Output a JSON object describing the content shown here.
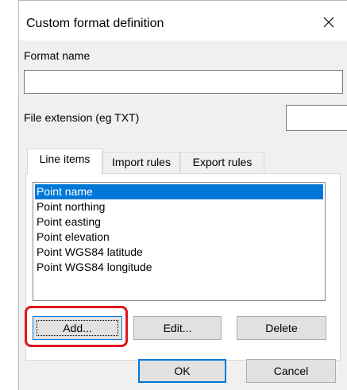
{
  "dialog": {
    "title": "Custom format definition",
    "close_icon": "close-icon"
  },
  "format_name": {
    "label": "Format name",
    "value": ""
  },
  "file_extension": {
    "label": "File extension (eg TXT)",
    "value": ""
  },
  "tabs": [
    {
      "label": "Line items",
      "active": true
    },
    {
      "label": "Import rules",
      "active": false
    },
    {
      "label": "Export rules",
      "active": false
    }
  ],
  "line_items": [
    {
      "label": "Point name",
      "selected": true
    },
    {
      "label": "Point northing",
      "selected": false
    },
    {
      "label": "Point easting",
      "selected": false
    },
    {
      "label": "Point elevation",
      "selected": false
    },
    {
      "label": "Point WGS84 latitude",
      "selected": false
    },
    {
      "label": "Point WGS84 longitude",
      "selected": false
    }
  ],
  "buttons": {
    "add": "Add...",
    "edit": "Edit...",
    "delete": "Delete",
    "ok": "OK",
    "cancel": "Cancel"
  },
  "colors": {
    "selection": "#0078d7",
    "highlight": "#e0151d"
  }
}
